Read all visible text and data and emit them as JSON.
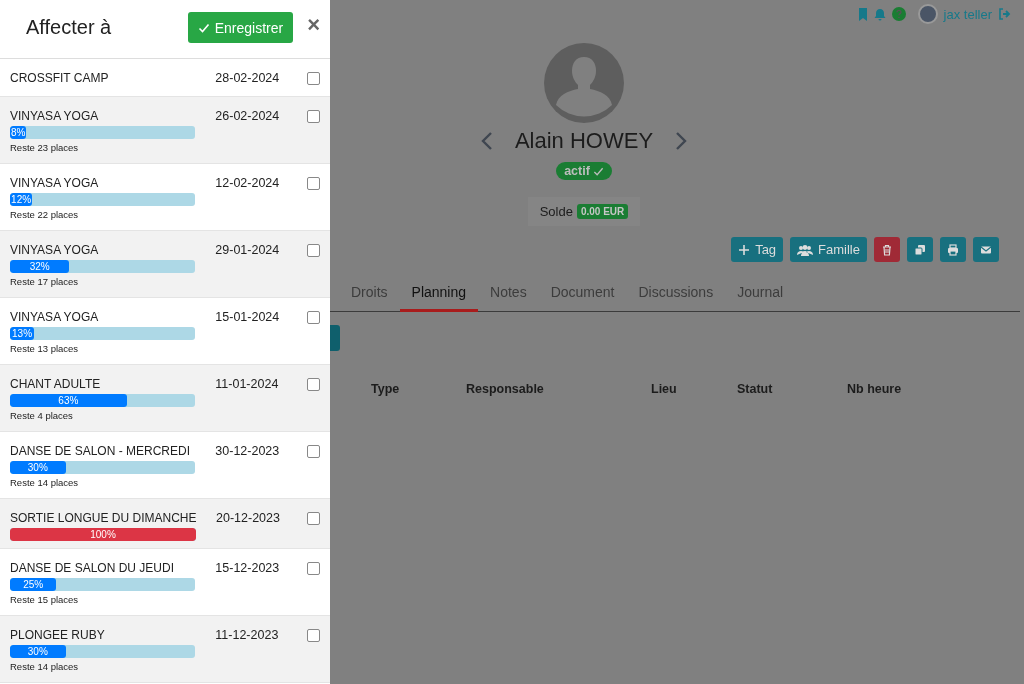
{
  "panel": {
    "title": "Affecter à",
    "save_button": "Enregistrer",
    "close": "×",
    "items": [
      {
        "name": "CROSSFIT CAMP",
        "date": "28-02-2024",
        "checked": false
      },
      {
        "name": "VINYASA YOGA",
        "date": "26-02-2024",
        "checked": false,
        "level": 0.08,
        "percent": "8%",
        "remaining": "Reste 23 places",
        "color": "#007bff"
      },
      {
        "name": "VINYASA YOGA",
        "date": "12-02-2024",
        "checked": false,
        "level": 0.12,
        "percent": "12%",
        "remaining": "Reste 22 places",
        "color": "#007bff"
      },
      {
        "name": "VINYASA YOGA",
        "date": "29-01-2024",
        "checked": false,
        "level": 0.32,
        "percent": "32%",
        "remaining": "Reste 17 places",
        "color": "#007bff"
      },
      {
        "name": "VINYASA YOGA",
        "date": "15-01-2024",
        "checked": false,
        "level": 0.13,
        "percent": "13%",
        "remaining": "Reste 13 places",
        "color": "#007bff"
      },
      {
        "name": "CHANT ADULTE",
        "date": "11-01-2024",
        "checked": false,
        "level": 0.63,
        "percent": "63%",
        "remaining": "Reste 4 places",
        "color": "#007bff"
      },
      {
        "name": "DANSE DE SALON - MERCREDI",
        "date": "30-12-2023",
        "checked": false,
        "level": 0.3,
        "percent": "30%",
        "remaining": "Reste 14 places",
        "color": "#007bff"
      },
      {
        "name": "SORTIE LONGUE DU DIMANCHE",
        "date": "20-12-2023",
        "checked": false,
        "level": 1,
        "percent": "100%",
        "color": "#dc3545"
      },
      {
        "name": "DANSE DE SALON DU JEUDI",
        "date": "15-12-2023",
        "checked": false,
        "level": 0.25,
        "percent": "25%",
        "remaining": "Reste 15 places",
        "color": "#007bff"
      },
      {
        "name": "PLONGEE RUBY",
        "date": "11-12-2023",
        "checked": false,
        "level": 0.3,
        "percent": "30%",
        "remaining": "Reste 14 places",
        "color": "#007bff"
      }
    ]
  },
  "topbar": {
    "user": "jax teller"
  },
  "profile": {
    "name": "Alain HOWEY",
    "status": "actif",
    "balance_label": "Solde",
    "balance": "0.00 EUR"
  },
  "actions": [
    {
      "kind": "tag",
      "label": "Tag"
    },
    {
      "kind": "family",
      "label": "Famille"
    },
    {
      "kind": "delete"
    },
    {
      "kind": "copy"
    },
    {
      "kind": "print"
    },
    {
      "kind": "mail"
    }
  ],
  "tabs": [
    {
      "label": "Droits",
      "selected": false
    },
    {
      "label": "Planning",
      "selected": true
    },
    {
      "label": "Notes",
      "selected": false
    },
    {
      "label": "Document",
      "selected": false
    },
    {
      "label": "Discussions",
      "selected": false
    },
    {
      "label": "Journal",
      "selected": false
    }
  ],
  "table": {
    "columns": [
      "Type",
      "Responsable",
      "Lieu",
      "Statut",
      "Nb heure"
    ]
  }
}
